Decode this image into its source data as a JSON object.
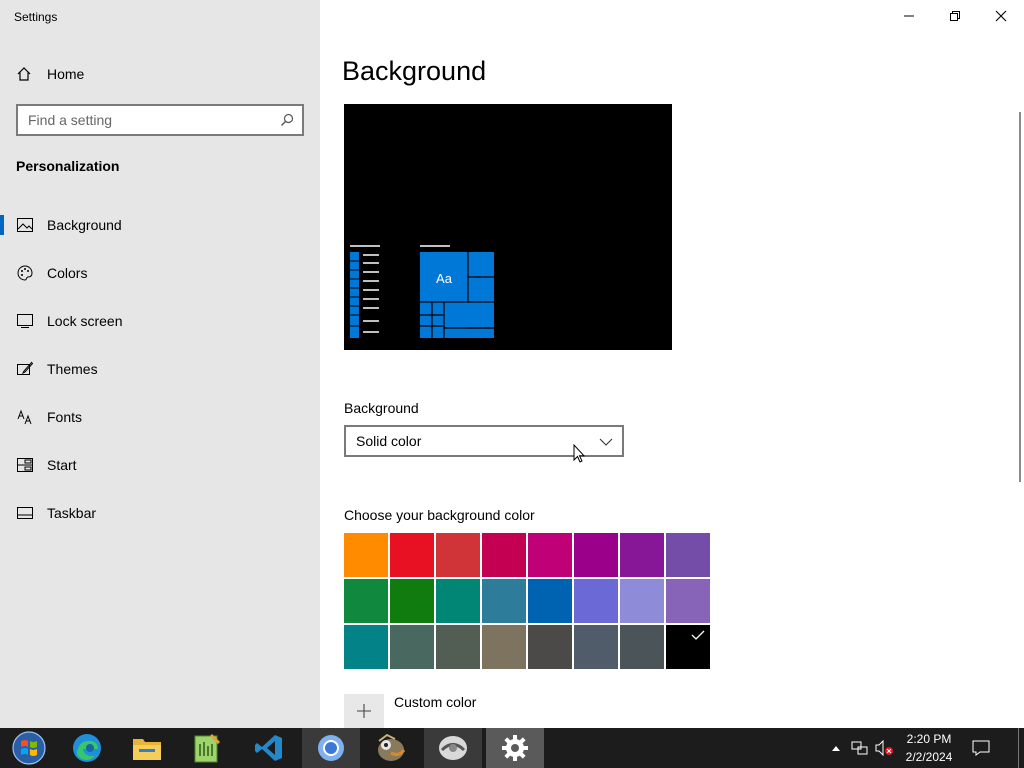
{
  "window": {
    "title": "Settings"
  },
  "sidebar": {
    "home_label": "Home",
    "search_placeholder": "Find a setting",
    "section_title": "Personalization",
    "items": [
      {
        "label": "Background",
        "icon": "picture-icon",
        "active": true
      },
      {
        "label": "Colors",
        "icon": "palette-icon",
        "active": false
      },
      {
        "label": "Lock screen",
        "icon": "lock-screen-icon",
        "active": false
      },
      {
        "label": "Themes",
        "icon": "brush-icon",
        "active": false
      },
      {
        "label": "Fonts",
        "icon": "font-icon",
        "active": false
      },
      {
        "label": "Start",
        "icon": "start-tiles-icon",
        "active": false
      },
      {
        "label": "Taskbar",
        "icon": "taskbar-icon",
        "active": false
      }
    ]
  },
  "main": {
    "title": "Background",
    "preview": {
      "sample_text": "Aa",
      "background_color": "#000000",
      "accent_color": "#0078d7"
    },
    "background_dropdown": {
      "label": "Background",
      "selected": "Solid color"
    },
    "color_section": {
      "label": "Choose your background color",
      "swatches": [
        "#ff8c00",
        "#e81123",
        "#d13438",
        "#c30052",
        "#bf0077",
        "#9a0089",
        "#881798",
        "#744da9",
        "#10893e",
        "#107c10",
        "#018574",
        "#2d7d9a",
        "#0063b1",
        "#6b69d6",
        "#8e8cd8",
        "#8764b8",
        "#038387",
        "#486860",
        "#525e54",
        "#7e735f",
        "#4c4a48",
        "#515c6b",
        "#4a5459",
        "#000000"
      ],
      "selected_index": 23
    },
    "custom_color_label": "Custom color"
  },
  "taskbar": {
    "apps": [
      {
        "name": "start-button"
      },
      {
        "name": "edge-app"
      },
      {
        "name": "file-explorer-app"
      },
      {
        "name": "notepad-plus-app"
      },
      {
        "name": "vscode-app"
      },
      {
        "name": "chrome-app"
      },
      {
        "name": "gimp-app"
      },
      {
        "name": "media-app"
      },
      {
        "name": "settings-app"
      }
    ],
    "time": "2:20 PM",
    "date": "2/2/2024"
  }
}
